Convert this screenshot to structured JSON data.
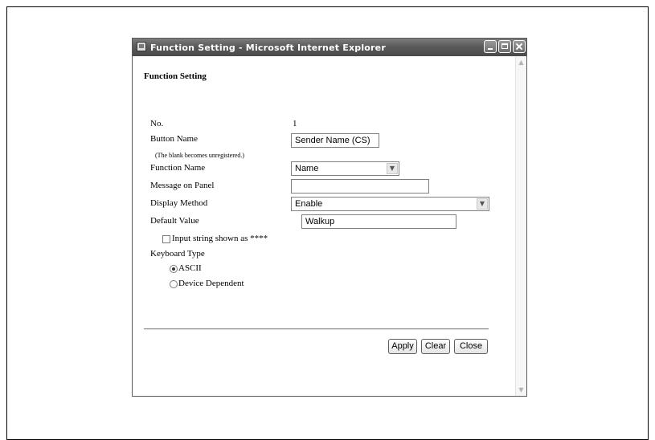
{
  "window": {
    "title": "Function Setting - Microsoft Internet Explorer"
  },
  "page": {
    "heading": "Function Setting",
    "no_label": "No.",
    "no_value": "1",
    "button_name_label": "Button Name",
    "button_name_value": "Sender Name (CS)",
    "blank_note": "(The blank becomes unregistered.)",
    "function_name_label": "Function Name",
    "function_name_selected": "Name",
    "message_label": "Message on Panel",
    "message_value": "",
    "display_method_label": "Display Method",
    "display_method_selected": "Enable",
    "default_value_label": "Default Value",
    "default_value_value": "Walkup",
    "input_string_label": "Input string shown as ****",
    "input_string_checked": false,
    "keyboard_type_label": "Keyboard Type",
    "keyboard_options": [
      "ASCII",
      "Device Dependent"
    ],
    "keyboard_selected": "ASCII"
  },
  "buttons": {
    "apply": "Apply",
    "clear": "Clear",
    "close": "Close"
  },
  "icons": {
    "app": "ie-document-icon",
    "minimize": "minimize-icon",
    "maximize": "maximize-icon",
    "close": "close-icon",
    "scroll_up": "scroll-up-arrow-icon",
    "scroll_down": "scroll-down-arrow-icon",
    "dropdown": "dropdown-arrow-icon"
  }
}
